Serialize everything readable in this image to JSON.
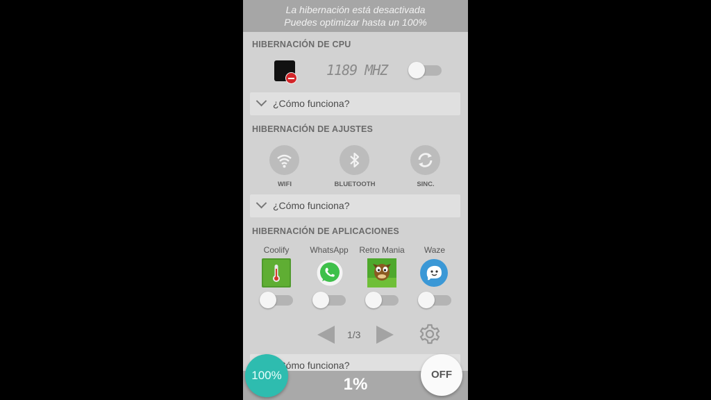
{
  "banner": {
    "line1": "La hibernación está desactivada",
    "line2": "Puedes optimizar hasta un 100%"
  },
  "cpu": {
    "title": "HIBERNACIÓN DE CPU",
    "frequency": "1189 MHZ",
    "toggle_on": false,
    "howto": "¿Cómo funciona?"
  },
  "settings": {
    "title": "HIBERNACIÓN DE AJUSTES",
    "items": [
      {
        "label": "WIFI",
        "icon": "wifi-icon"
      },
      {
        "label": "BLUETOOTH",
        "icon": "bluetooth-icon"
      },
      {
        "label": "SINC.",
        "icon": "sync-icon"
      }
    ],
    "howto": "¿Cómo funciona?"
  },
  "apps": {
    "title": "HIBERNACIÓN DE APLICACIONES",
    "items": [
      {
        "name": "Coolify",
        "icon": "thermometer-icon",
        "toggle_on": false
      },
      {
        "name": "WhatsApp",
        "icon": "whatsapp-icon",
        "toggle_on": false
      },
      {
        "name": "Retro Mania",
        "icon": "retro-mania-icon",
        "toggle_on": false
      },
      {
        "name": "Waze",
        "icon": "waze-icon",
        "toggle_on": false
      }
    ],
    "pager": "1/3",
    "howto": "¿Cómo funciona?"
  },
  "bottom": {
    "percent": "1%",
    "fab_left": "100%",
    "fab_right": "OFF"
  },
  "colors": {
    "accent": "#2ebcaf",
    "background": "#d2d2d2",
    "banner": "#a6a6a6"
  }
}
